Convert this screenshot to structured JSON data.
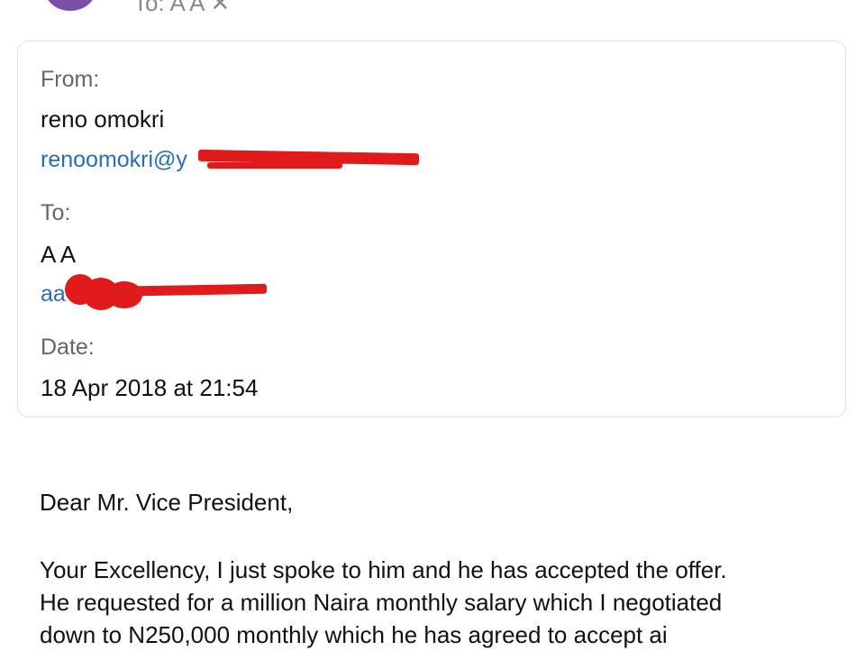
{
  "header": {
    "to_summary": "To: A A"
  },
  "details": {
    "from_label": "From:",
    "from_name": "reno omokri",
    "from_email": "renoomokri@y",
    "to_label": "To:",
    "to_name": "A A",
    "to_email": "aa",
    "date_label": "Date:",
    "date_value": "18 Apr 2018 at 21:54"
  },
  "message": {
    "salutation": "Dear Mr. Vice President,",
    "line1": "Your Excellency, I just spoke to him and he has accepted the offer.",
    "line2": "He requested for a million Naira monthly salary which I negotiated",
    "line3": "down to N250,000 monthly which he has agreed to accept ai"
  },
  "colors": {
    "redaction": "#e11b1b",
    "link": "#2a6db3",
    "avatar": "#7a4fa8"
  }
}
